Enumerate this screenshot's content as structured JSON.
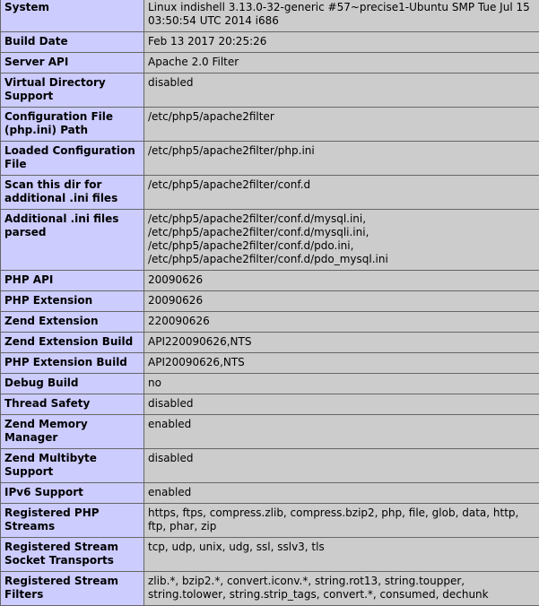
{
  "rows": [
    {
      "key": "System",
      "value": "Linux indishell 3.13.0-32-generic #57~precise1-Ubuntu SMP Tue Jul 15 03:50:54 UTC 2014 i686"
    },
    {
      "key": "Build Date",
      "value": "Feb 13 2017 20:25:26"
    },
    {
      "key": "Server API",
      "value": "Apache 2.0 Filter"
    },
    {
      "key": "Virtual Directory Support",
      "value": "disabled"
    },
    {
      "key": "Configuration File (php.ini) Path",
      "value": "/etc/php5/apache2filter"
    },
    {
      "key": "Loaded Configuration File",
      "value": "/etc/php5/apache2filter/php.ini"
    },
    {
      "key": "Scan this dir for additional .ini files",
      "value": "/etc/php5/apache2filter/conf.d"
    },
    {
      "key": "Additional .ini files parsed",
      "value": "/etc/php5/apache2filter/conf.d/mysql.ini, /etc/php5/apache2filter/conf.d/mysqli.ini, /etc/php5/apache2filter/conf.d/pdo.ini, /etc/php5/apache2filter/conf.d/pdo_mysql.ini"
    },
    {
      "key": "PHP API",
      "value": "20090626"
    },
    {
      "key": "PHP Extension",
      "value": "20090626"
    },
    {
      "key": "Zend Extension",
      "value": "220090626"
    },
    {
      "key": "Zend Extension Build",
      "value": "API220090626,NTS"
    },
    {
      "key": "PHP Extension Build",
      "value": "API20090626,NTS"
    },
    {
      "key": "Debug Build",
      "value": "no"
    },
    {
      "key": "Thread Safety",
      "value": "disabled"
    },
    {
      "key": "Zend Memory Manager",
      "value": "enabled"
    },
    {
      "key": "Zend Multibyte Support",
      "value": "disabled"
    },
    {
      "key": "IPv6 Support",
      "value": "enabled"
    },
    {
      "key": "Registered PHP Streams",
      "value": "https, ftps, compress.zlib, compress.bzip2, php, file, glob, data, http, ftp, phar, zip"
    },
    {
      "key": "Registered Stream Socket Transports",
      "value": "tcp, udp, unix, udg, ssl, sslv3, tls"
    },
    {
      "key": "Registered Stream Filters",
      "value": "zlib.*, bzip2.*, convert.iconv.*, string.rot13, string.toupper, string.tolower, string.strip_tags, convert.*, consumed, dechunk"
    }
  ]
}
